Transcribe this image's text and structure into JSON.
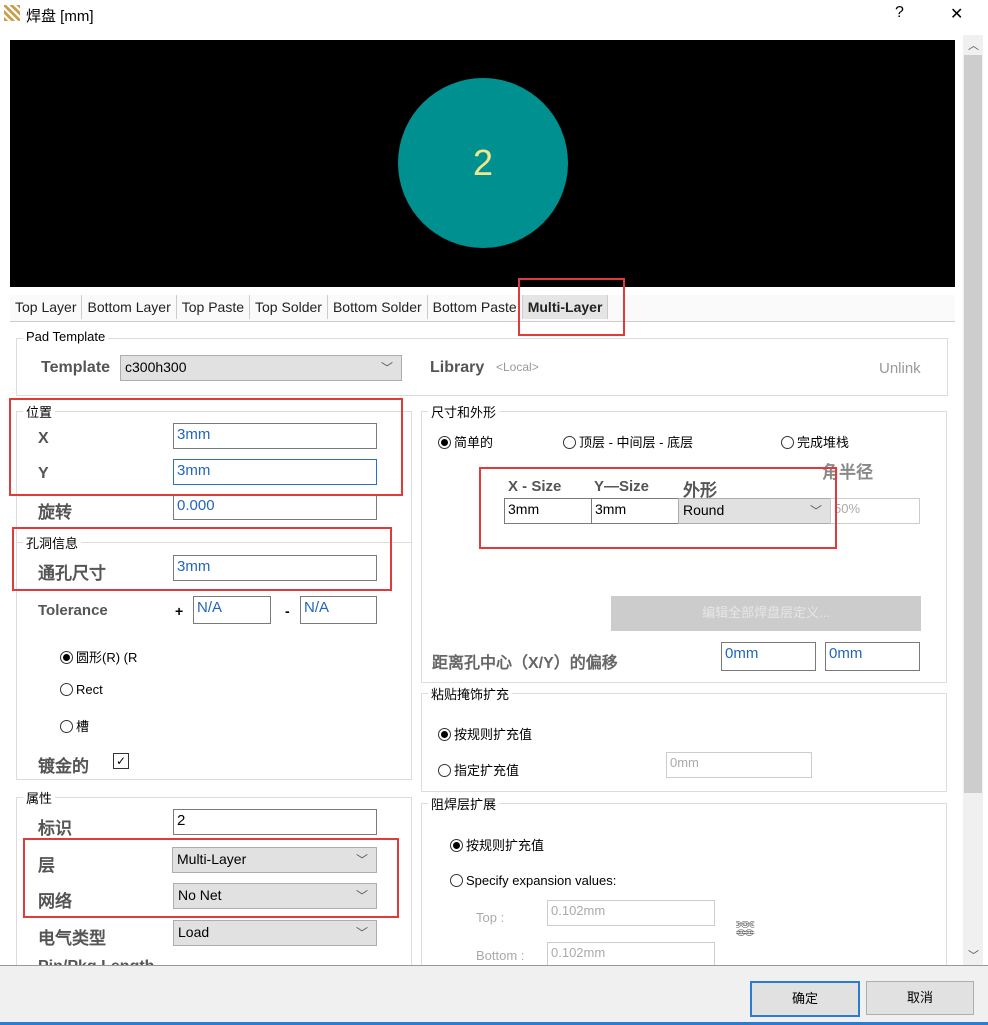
{
  "window": {
    "title": "焊盘 [mm]",
    "help": "?",
    "close": "✕"
  },
  "preview": {
    "pad_label": "2",
    "pad_color": "#009090",
    "label_color": "#f0e68c"
  },
  "tabs": [
    "Top Layer",
    "Bottom Layer",
    "Top Paste",
    "Top Solder",
    "Bottom Solder",
    "Bottom Paste",
    "Multi-Layer"
  ],
  "pad_template": {
    "title": "Pad Template",
    "template_label": "Template",
    "template_value": "c300h300",
    "library_label": "Library",
    "library_value": "<Local>",
    "unlink": "Unlink"
  },
  "position": {
    "title": "位置",
    "x_label": "X",
    "x_value": "3mm",
    "y_label": "Y",
    "y_value": "3mm",
    "rotation_label": "旋转",
    "rotation_value": "0.000"
  },
  "hole": {
    "title": "孔洞信息",
    "size_label": "通孔尺寸",
    "size_value": "3mm",
    "tolerance_label": "Tolerance",
    "plus": "+",
    "plus_value": "N/A",
    "minus": "-",
    "minus_value": "N/A",
    "shapes": [
      "圆形(R) (R",
      "Rect",
      "槽"
    ],
    "plated_label": "镀金的"
  },
  "properties": {
    "title": "属性",
    "designator_label": "标识",
    "designator_value": "2",
    "layer_label": "层",
    "layer_value": "Multi-Layer",
    "net_label": "网络",
    "net_value": "No Net",
    "electrical_label": "电气类型",
    "electrical_value": "Load",
    "pin_length_label": "Pin/Pkg Length"
  },
  "size_shape": {
    "title": "尺寸和外形",
    "modes": [
      "简单的",
      "顶层 - 中间层 - 底层",
      "完成堆栈"
    ],
    "x_size_label": "X - Size",
    "y_size_label": "Y—Size",
    "shape_label": "外形",
    "corner_label": "角半径",
    "x_size": "3mm",
    "y_size": "3mm",
    "shape": "Round",
    "corner": "50%",
    "edit_button": "编辑全部焊盘层定义...",
    "offset_label": "距离孔中心（X/Y）的偏移",
    "offset_x": "0mm",
    "offset_y": "0mm"
  },
  "paste": {
    "title": "粘贴掩饰扩充",
    "rule": "按规则扩充值",
    "specify": "指定扩充值",
    "value": "0mm"
  },
  "solder": {
    "title": "阻焊层扩展",
    "rule": "按规则扩充值",
    "specify": "Specify expansion values:",
    "top_label": "Top :",
    "top_value": "0.102mm",
    "bottom_label": "Bottom :",
    "bottom_value": "0.102mm"
  },
  "footer": {
    "ok": "确定",
    "cancel": "取消"
  }
}
